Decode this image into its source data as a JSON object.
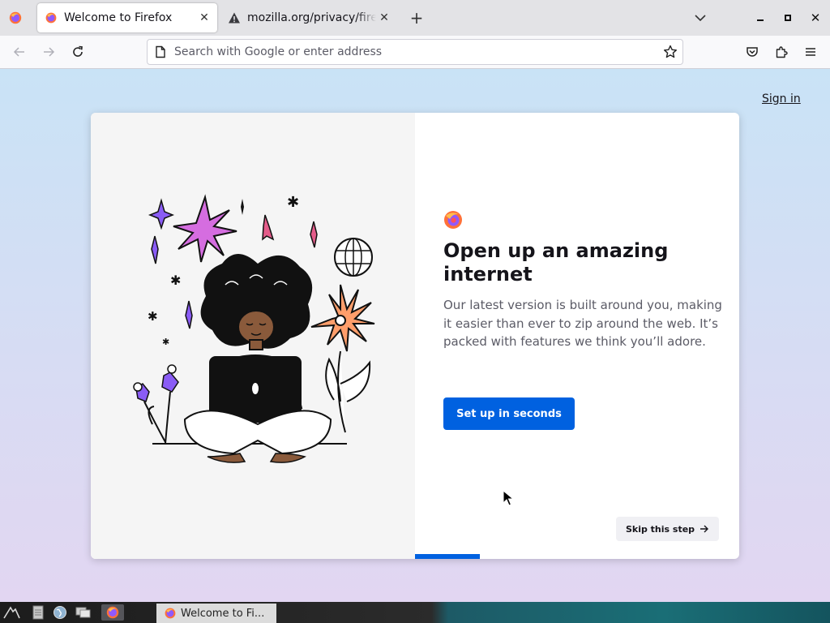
{
  "tabs": [
    {
      "title": "Welcome to Firefox",
      "active": true,
      "icon": "firefox-icon"
    },
    {
      "title": "mozilla.org/privacy/firefox",
      "active": false,
      "icon": "warning-icon"
    }
  ],
  "urlbar": {
    "placeholder": "Search with Google or enter address",
    "value": ""
  },
  "page": {
    "sign_in": "Sign in",
    "heading": "Open up an amazing internet",
    "subtitle": "Our latest version is built around you, making it easier than ever to zip around the web. It’s packed with features we think you’ll adore.",
    "primary_button": "Set up in seconds",
    "skip_button": "Skip this step",
    "progress_fraction": 0.2
  },
  "taskbar": {
    "task_label": "Welcome to Fi..."
  },
  "colors": {
    "accent": "#0061e0",
    "heading": "#15141a",
    "body_text": "#5b5b66"
  }
}
